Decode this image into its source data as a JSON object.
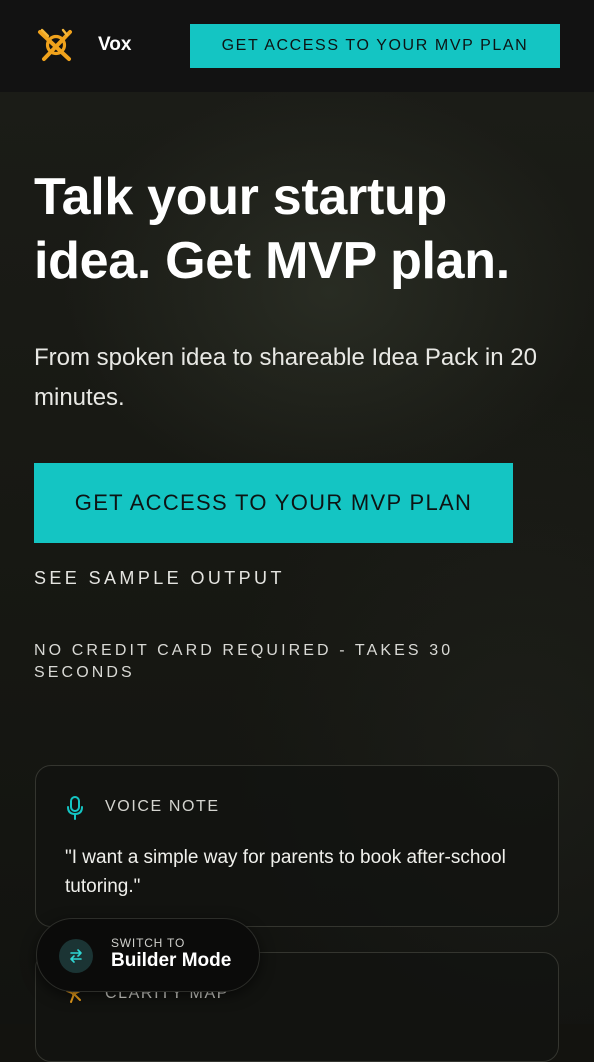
{
  "header": {
    "brand": "Vox",
    "cta_label": "GET ACCESS TO YOUR MVP PLAN"
  },
  "hero": {
    "title": "Talk your startup idea. Get MVP plan.",
    "subtitle": "From spoken idea to shareable Idea Pack in 20 minutes.",
    "cta_label": "GET ACCESS TO YOUR MVP PLAN",
    "secondary_link": "SEE SAMPLE OUTPUT",
    "note": "NO CREDIT CARD REQUIRED - TAKES 30 SECONDS"
  },
  "cards": [
    {
      "icon": "microphone-icon",
      "label": "VOICE NOTE",
      "quote": "\"I want a simple way for parents to book after-school tutoring.\""
    },
    {
      "icon": "sparkle-icon",
      "label": "CLARITY MAP"
    }
  ],
  "switch": {
    "small_label": "SWITCH TO",
    "mode_label": "Builder Mode",
    "icon": "swap-arrows-icon"
  },
  "colors": {
    "accent": "#14c5c3",
    "logo": "#f0a21c",
    "background": "#13130f"
  }
}
